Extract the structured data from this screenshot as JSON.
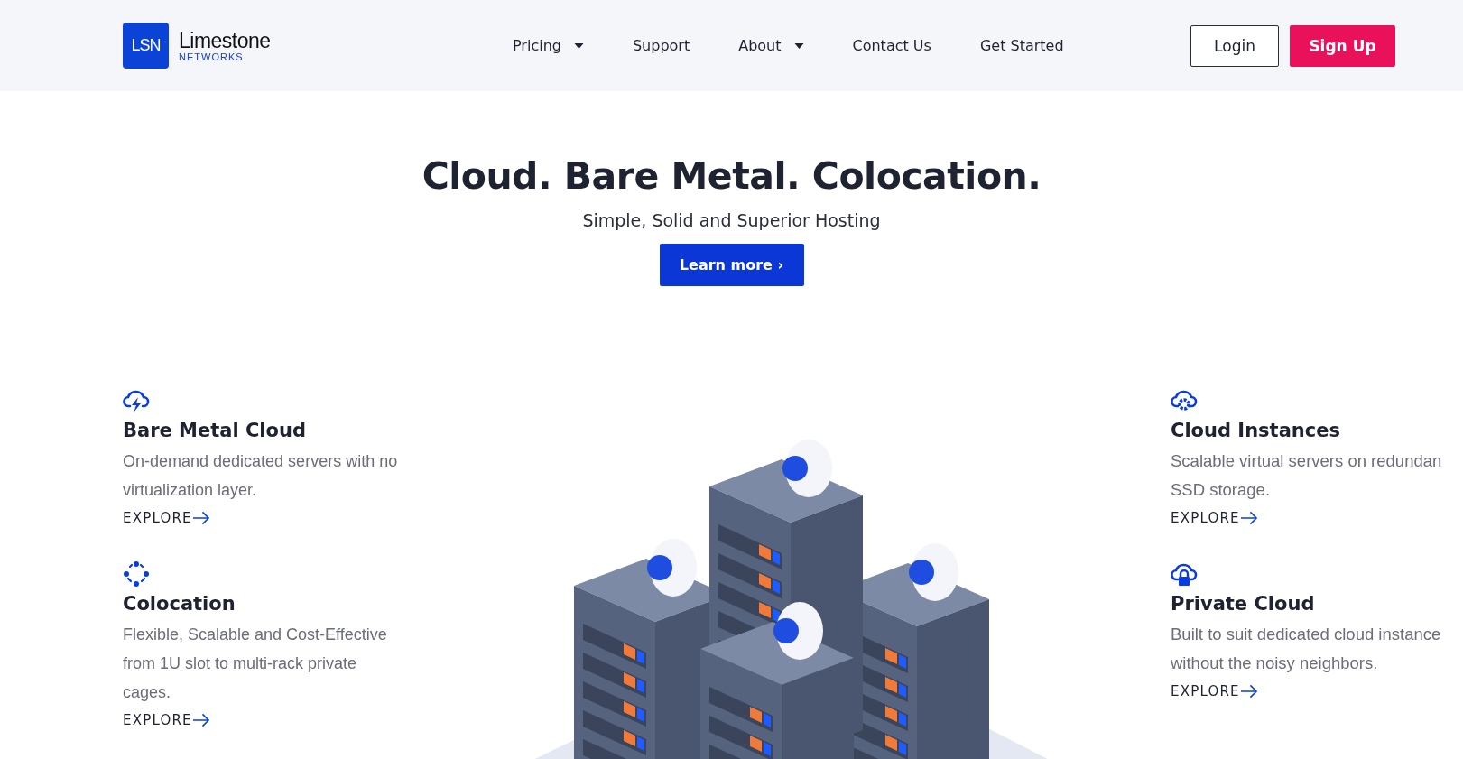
{
  "logo": {
    "mark": "LSN",
    "name": "Limestone",
    "sub": "NETWORKS"
  },
  "nav": [
    {
      "label": "Pricing",
      "dropdown": true
    },
    {
      "label": "Support",
      "dropdown": false
    },
    {
      "label": "About",
      "dropdown": true
    },
    {
      "label": "Contact Us",
      "dropdown": false
    },
    {
      "label": "Get Started",
      "dropdown": false
    }
  ],
  "auth": {
    "login": "Login",
    "signup": "Sign Up"
  },
  "hero": {
    "title": "Cloud. Bare Metal. Colocation.",
    "subtitle": "Simple, Solid and Superior Hosting",
    "button": "Learn more ›"
  },
  "features_left": [
    {
      "kind": "bolt-cloud",
      "title": "Bare Metal Cloud",
      "description": "On-demand dedicated servers with no\nvirtualization layer.",
      "link": "EXPLORE"
    },
    {
      "kind": "dots-ring",
      "title": "Colocation",
      "description": "Flexible, Scalable and Cost-Effective\nfrom 1U slot to multi-rack private\ncages.",
      "link": "EXPLORE"
    }
  ],
  "features_right": [
    {
      "kind": "gear-cloud",
      "title": "Cloud Instances",
      "description": "Scalable virtual servers on redundan\nSSD storage.",
      "link": "EXPLORE"
    },
    {
      "kind": "lock-cloud",
      "title": "Private Cloud",
      "description": "Built to suit dedicated cloud instance\nwithout the noisy neighbors.",
      "link": "EXPLORE"
    }
  ]
}
